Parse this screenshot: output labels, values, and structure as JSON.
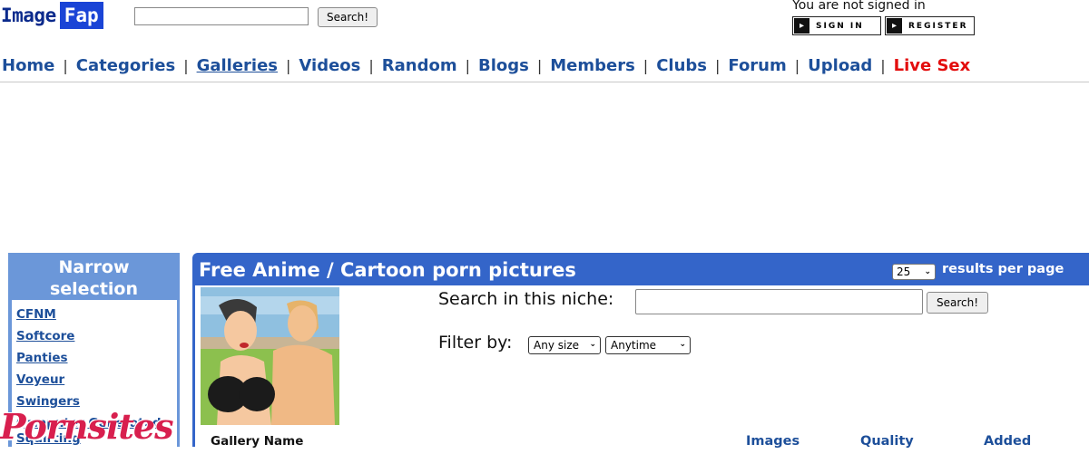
{
  "logo": {
    "word1": "Image",
    "word2": "Fap"
  },
  "search": {
    "button": "Search!",
    "value": ""
  },
  "account": {
    "status": "You are not signed in",
    "signin": "SIGN IN",
    "register": "REGISTER"
  },
  "nav": {
    "items": [
      {
        "label": "Home"
      },
      {
        "label": "Categories"
      },
      {
        "label": "Galleries"
      },
      {
        "label": "Videos"
      },
      {
        "label": "Random"
      },
      {
        "label": "Blogs"
      },
      {
        "label": "Members"
      },
      {
        "label": "Clubs"
      },
      {
        "label": "Forum"
      },
      {
        "label": "Upload"
      },
      {
        "label": "Live Sex"
      }
    ],
    "separator": "|"
  },
  "sidebar": {
    "title_line1": "Narrow",
    "title_line2": "selection",
    "links": [
      {
        "label": "CFNM"
      },
      {
        "label": "Softcore"
      },
      {
        "label": "Panties"
      },
      {
        "label": "Voyeur"
      },
      {
        "label": "Swingers"
      },
      {
        "label": "Computer Generated"
      },
      {
        "label": "Squirting"
      }
    ]
  },
  "main": {
    "title": "Free Anime / Cartoon porn pictures",
    "results_per_page": {
      "value": "25",
      "label": "results per page"
    },
    "niche_search": {
      "label": "Search in this niche:",
      "button": "Search!",
      "value": ""
    },
    "filter": {
      "label": "Filter by:",
      "size": "Any size",
      "time": "Anytime"
    },
    "columns": {
      "gallery": "Gallery Name",
      "images": "Images",
      "quality": "Quality",
      "added": "Added"
    }
  },
  "watermark": "Pornsites",
  "colors": {
    "nav_link": "#1d4f9a",
    "live": "#e30d0d",
    "panel": "#3465c9",
    "sidebar": "#6b97d9",
    "logo_blue": "#1a44d6"
  }
}
